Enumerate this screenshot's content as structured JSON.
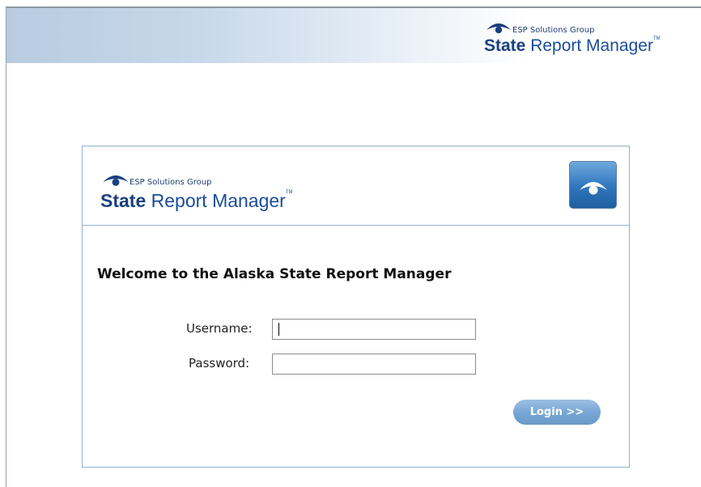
{
  "header": {
    "logo": {
      "group_name": "ESP Solutions Group",
      "product_bold": "State",
      "product_rest": " Report Manager",
      "tm": "TM"
    }
  },
  "login_card": {
    "logo": {
      "group_name": "ESP Solutions Group",
      "product_bold": "State",
      "product_rest": " Report Manager",
      "tm": "TM"
    },
    "app_icon": "eye-arc-icon",
    "welcome_text": "Welcome to the Alaska State Report Manager",
    "username_label": "Username:",
    "username_value": "",
    "password_label": "Password:",
    "password_value": "",
    "login_button_label": "Login >>"
  },
  "colors": {
    "brand_blue": "#1a4d9a",
    "card_border": "#8eb1d4",
    "button_blue": "#7aa8d6"
  }
}
